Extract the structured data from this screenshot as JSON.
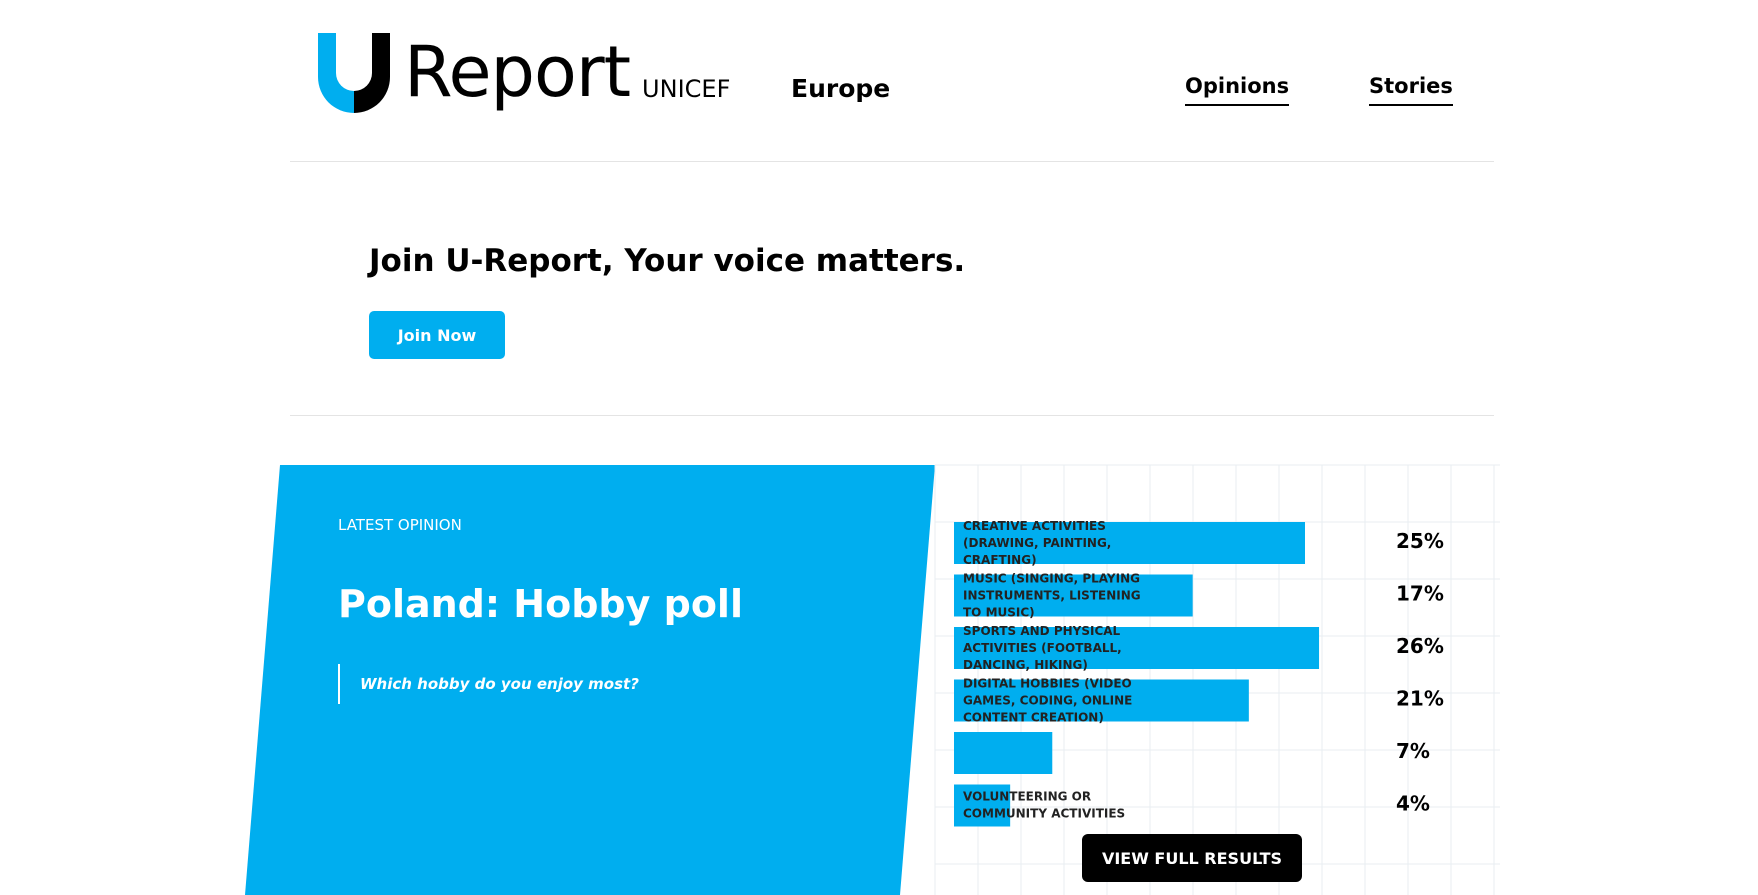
{
  "header": {
    "logo_text": "Report",
    "logo_sub": "UNICEF",
    "region": "Europe",
    "nav": [
      {
        "label": "Opinions"
      },
      {
        "label": "Stories"
      }
    ]
  },
  "join": {
    "title": "Join U-Report, Your voice matters.",
    "button_label": "Join Now"
  },
  "opinion": {
    "eyebrow": "LATEST OPINION",
    "title": "Poland: Hobby poll",
    "question": "Which hobby do you enjoy most?",
    "view_button": "VIEW FULL RESULTS"
  },
  "colors": {
    "accent": "#00aeef",
    "dark": "#000000"
  },
  "chart_data": {
    "type": "bar",
    "orientation": "horizontal",
    "categories": [
      "CREATIVE ACTIVITIES (DRAWING, PAINTING, CRAFTING)",
      "MUSIC (SINGING, PLAYING INSTRUMENTS, LISTENING TO MUSIC)",
      "SPORTS AND PHYSICAL ACTIVITIES (FOOTBALL, DANCING, HIKING)",
      "DIGITAL HOBBIES (VIDEO GAMES, CODING, ONLINE CONTENT CREATION)",
      "",
      "VOLUNTEERING OR COMMUNITY ACTIVITIES"
    ],
    "values": [
      25,
      17,
      26,
      21,
      7,
      4
    ],
    "value_labels": [
      "25%",
      "17%",
      "26%",
      "21%",
      "7%",
      "4%"
    ],
    "xlim": [
      0,
      30
    ],
    "grid": true
  }
}
